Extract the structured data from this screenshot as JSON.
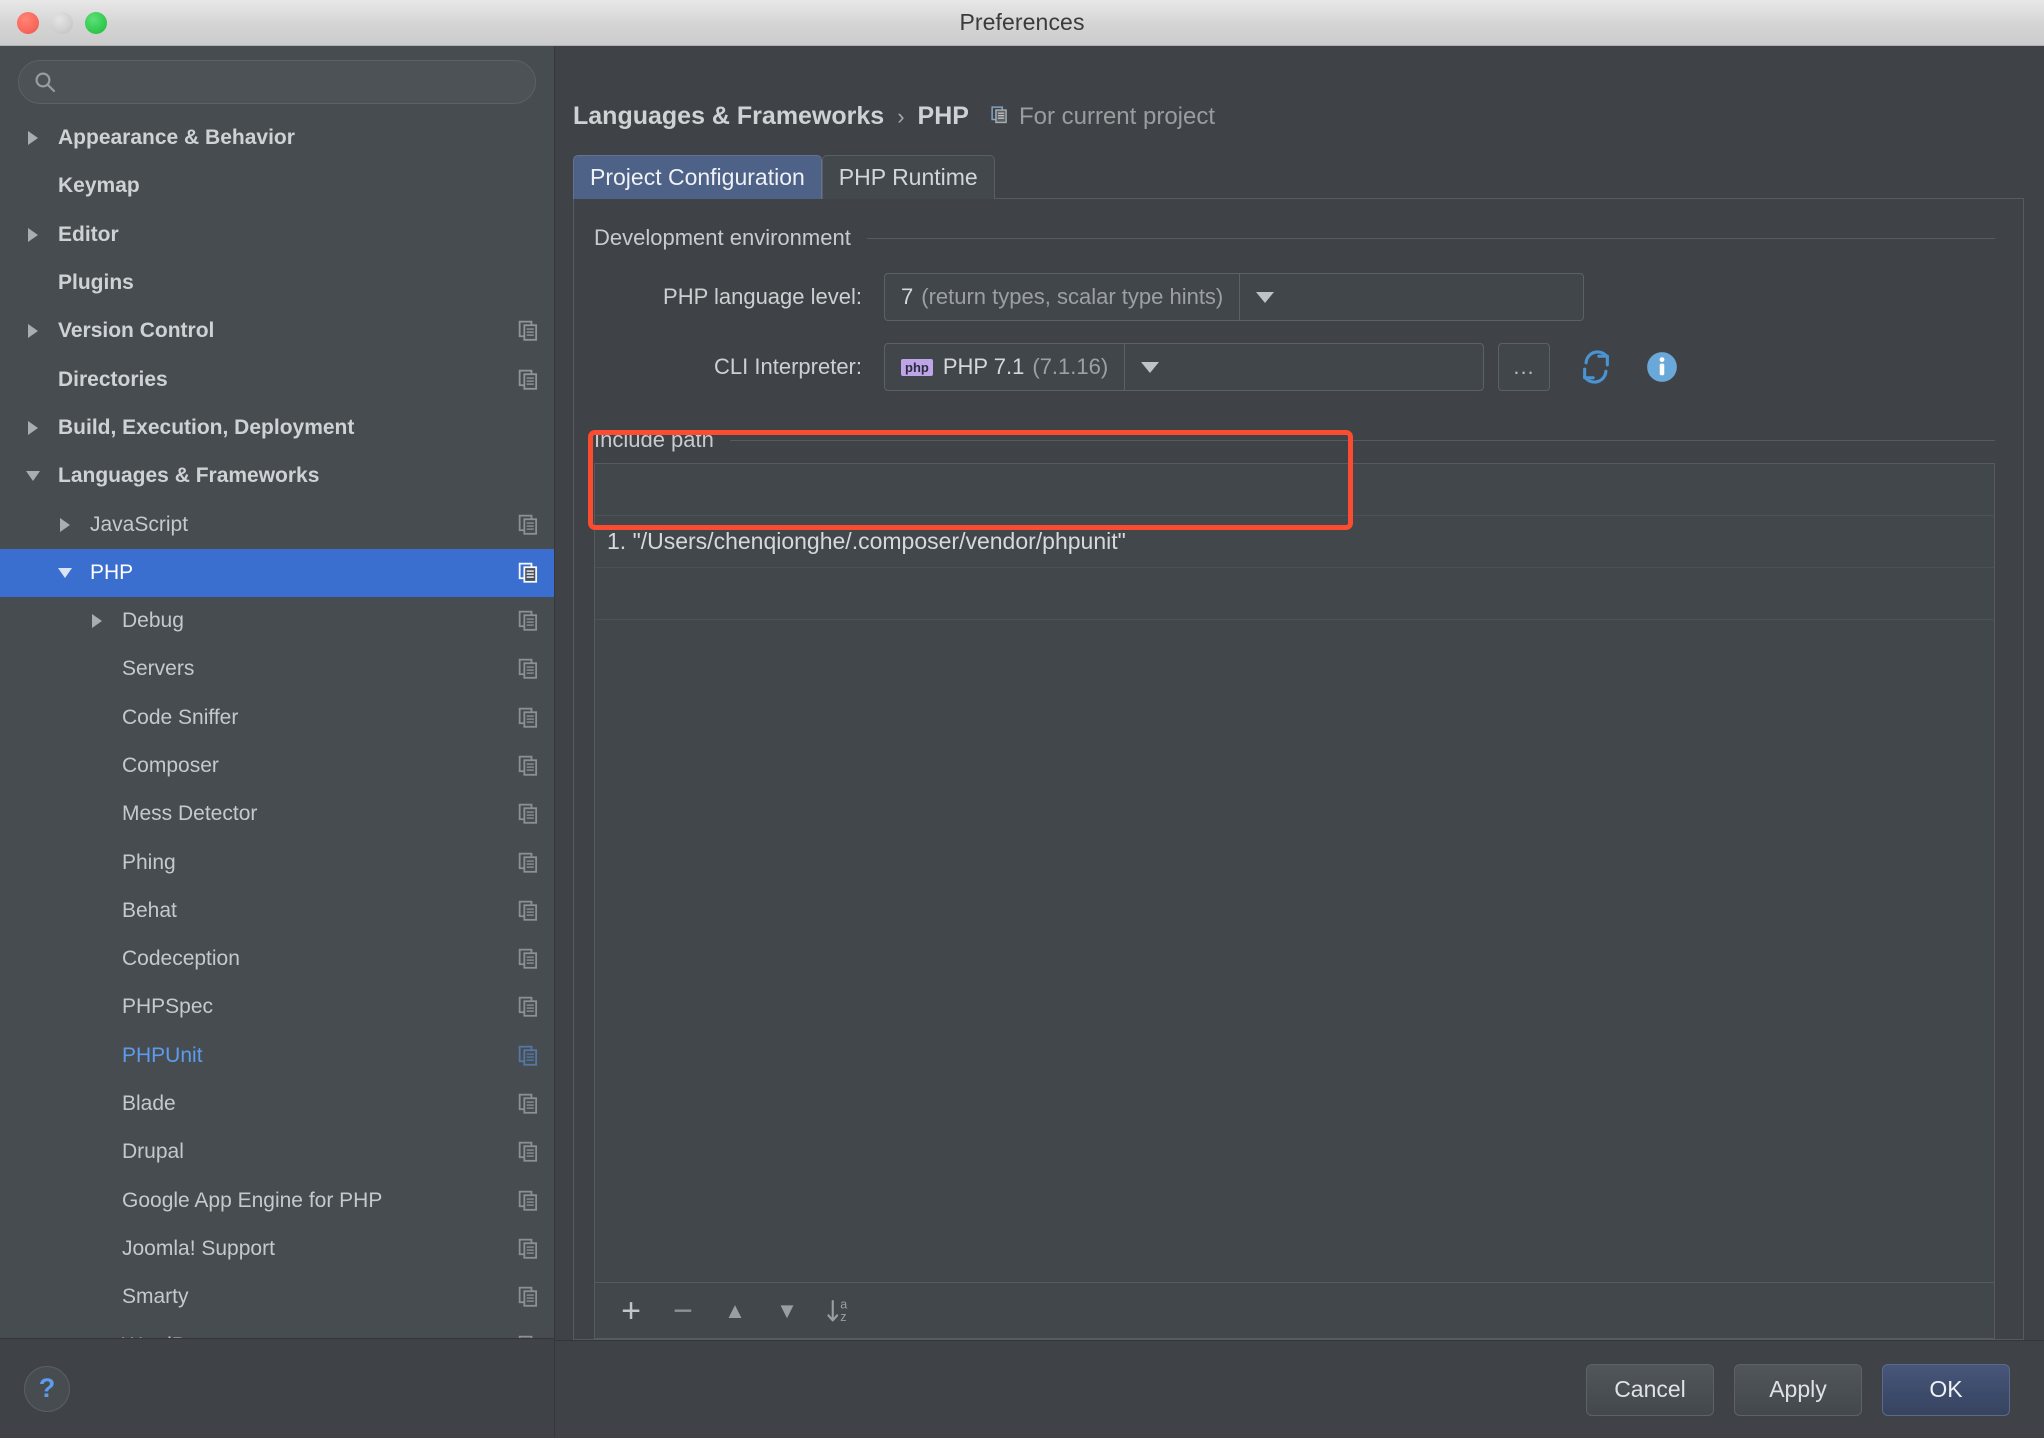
{
  "window": {
    "title": "Preferences",
    "traffic_lights": [
      "close",
      "minimize",
      "maximize"
    ]
  },
  "sidebar": {
    "search": {
      "value": "",
      "placeholder": ""
    },
    "help_label": "?",
    "items": [
      {
        "label": "Appearance & Behavior",
        "indent": 0,
        "arrow": "right",
        "bold": true,
        "copy": false,
        "state": "normal"
      },
      {
        "label": "Keymap",
        "indent": 0,
        "arrow": "none",
        "bold": true,
        "copy": false,
        "state": "normal"
      },
      {
        "label": "Editor",
        "indent": 0,
        "arrow": "right",
        "bold": true,
        "copy": false,
        "state": "normal"
      },
      {
        "label": "Plugins",
        "indent": 0,
        "arrow": "none",
        "bold": true,
        "copy": false,
        "state": "normal"
      },
      {
        "label": "Version Control",
        "indent": 0,
        "arrow": "right",
        "bold": true,
        "copy": true,
        "state": "normal"
      },
      {
        "label": "Directories",
        "indent": 0,
        "arrow": "none",
        "bold": true,
        "copy": true,
        "state": "normal"
      },
      {
        "label": "Build, Execution, Deployment",
        "indent": 0,
        "arrow": "right",
        "bold": true,
        "copy": false,
        "state": "normal"
      },
      {
        "label": "Languages & Frameworks",
        "indent": 0,
        "arrow": "down",
        "bold": true,
        "copy": false,
        "state": "normal"
      },
      {
        "label": "JavaScript",
        "indent": 1,
        "arrow": "right",
        "bold": false,
        "copy": true,
        "state": "normal"
      },
      {
        "label": "PHP",
        "indent": 1,
        "arrow": "down",
        "bold": false,
        "copy": true,
        "state": "selected"
      },
      {
        "label": "Debug",
        "indent": 2,
        "arrow": "right",
        "bold": false,
        "copy": true,
        "state": "normal"
      },
      {
        "label": "Servers",
        "indent": 2,
        "arrow": "none",
        "bold": false,
        "copy": true,
        "state": "normal"
      },
      {
        "label": "Code Sniffer",
        "indent": 2,
        "arrow": "none",
        "bold": false,
        "copy": true,
        "state": "normal"
      },
      {
        "label": "Composer",
        "indent": 2,
        "arrow": "none",
        "bold": false,
        "copy": true,
        "state": "normal"
      },
      {
        "label": "Mess Detector",
        "indent": 2,
        "arrow": "none",
        "bold": false,
        "copy": true,
        "state": "normal"
      },
      {
        "label": "Phing",
        "indent": 2,
        "arrow": "none",
        "bold": false,
        "copy": true,
        "state": "normal"
      },
      {
        "label": "Behat",
        "indent": 2,
        "arrow": "none",
        "bold": false,
        "copy": true,
        "state": "normal"
      },
      {
        "label": "Codeception",
        "indent": 2,
        "arrow": "none",
        "bold": false,
        "copy": true,
        "state": "normal"
      },
      {
        "label": "PHPSpec",
        "indent": 2,
        "arrow": "none",
        "bold": false,
        "copy": true,
        "state": "normal"
      },
      {
        "label": "PHPUnit",
        "indent": 2,
        "arrow": "none",
        "bold": false,
        "copy": true,
        "state": "link"
      },
      {
        "label": "Blade",
        "indent": 2,
        "arrow": "none",
        "bold": false,
        "copy": true,
        "state": "normal"
      },
      {
        "label": "Drupal",
        "indent": 2,
        "arrow": "none",
        "bold": false,
        "copy": true,
        "state": "normal"
      },
      {
        "label": "Google App Engine for PHP",
        "indent": 2,
        "arrow": "none",
        "bold": false,
        "copy": true,
        "state": "normal"
      },
      {
        "label": "Joomla! Support",
        "indent": 2,
        "arrow": "none",
        "bold": false,
        "copy": true,
        "state": "normal"
      },
      {
        "label": "Smarty",
        "indent": 2,
        "arrow": "none",
        "bold": false,
        "copy": true,
        "state": "normal"
      },
      {
        "label": "WordPress",
        "indent": 2,
        "arrow": "none",
        "bold": false,
        "copy": true,
        "state": "normal"
      }
    ]
  },
  "breadcrumb": {
    "parent": "Languages & Frameworks",
    "separator": "›",
    "current": "PHP",
    "scope": "For current project"
  },
  "tabs": [
    {
      "label": "Project Configuration",
      "active": true
    },
    {
      "label": "PHP Runtime",
      "active": false
    }
  ],
  "dev_env": {
    "group_title": "Development environment",
    "language_level": {
      "label": "PHP language level:",
      "value_strong": "7",
      "value_muted": "(return types, scalar type hints)"
    },
    "cli_interpreter": {
      "label": "CLI Interpreter:",
      "badge": "php",
      "value_strong": "PHP 7.1",
      "value_muted": "(7.1.16)",
      "browse_label": "...",
      "refresh_icon": "refresh-icon",
      "info_icon": "info-icon"
    }
  },
  "include_path": {
    "group_title": "Include path",
    "rows": [
      {
        "text": ""
      },
      {
        "text": "1. \"/Users/chenqionghe/.composer/vendor/phpunit\""
      },
      {
        "text": ""
      }
    ],
    "toolbar": [
      {
        "name": "add",
        "glyph": "+"
      },
      {
        "name": "remove",
        "glyph": "−"
      },
      {
        "name": "move-up",
        "glyph": "▲"
      },
      {
        "name": "move-down",
        "glyph": "▼"
      },
      {
        "name": "sort-az",
        "glyph": "sort-az-icon"
      }
    ]
  },
  "footer": {
    "cancel": "Cancel",
    "apply": "Apply",
    "ok": "OK"
  },
  "colors": {
    "accent_selection": "#3a6fd0",
    "link": "#5d9cec",
    "highlight_box": "#fb4c32",
    "tab_active": "#4e6186",
    "php_badge": "#bda5e8"
  }
}
